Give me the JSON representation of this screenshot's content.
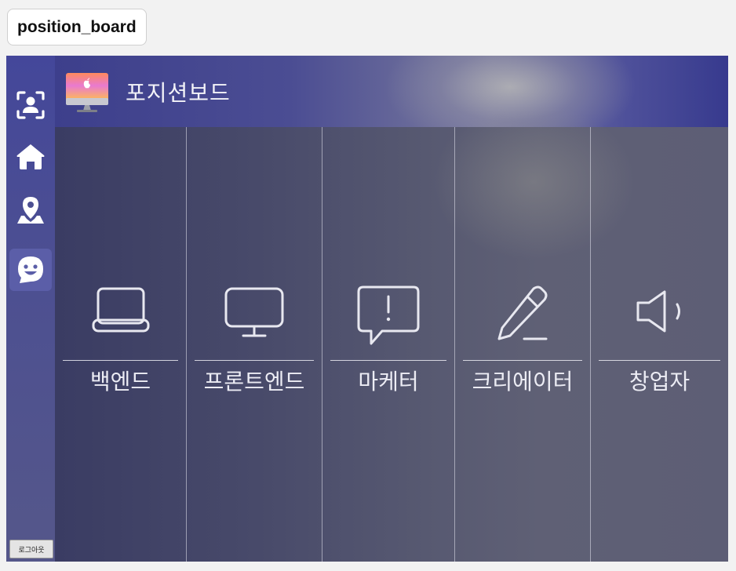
{
  "tag": {
    "label": "position_board"
  },
  "header": {
    "title": "포지션보드"
  },
  "sidebar": {
    "items": [
      {
        "name": "profile",
        "icon": "face-scan-icon"
      },
      {
        "name": "home",
        "icon": "home-icon"
      },
      {
        "name": "map",
        "icon": "map-pin-icon"
      },
      {
        "name": "chat",
        "icon": "smile-chat-icon",
        "active": true
      }
    ],
    "logout_label": "로그아웃"
  },
  "positions": [
    {
      "label": "백엔드",
      "icon": "laptop-icon"
    },
    {
      "label": "프론트엔드",
      "icon": "monitor-icon"
    },
    {
      "label": "마케터",
      "icon": "alert-speech-bubble-icon"
    },
    {
      "label": "크리에이터",
      "icon": "pencil-icon"
    },
    {
      "label": "창업자",
      "icon": "speaker-icon"
    }
  ],
  "colors": {
    "sidebar": "#4c4f92",
    "header": "#3d3f8c",
    "board": "#4f5170",
    "active_item": "#5b5ea8"
  }
}
